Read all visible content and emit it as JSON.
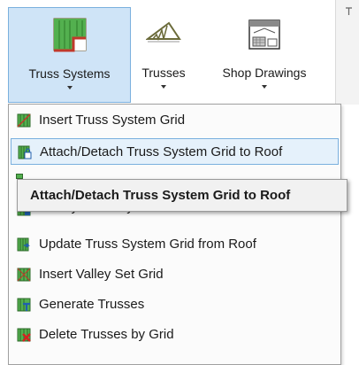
{
  "ribbon": {
    "buttons": [
      {
        "label": "Truss Systems",
        "icon": "truss-system-icon",
        "selected": true
      },
      {
        "label": "Trusses",
        "icon": "truss-icon"
      },
      {
        "label": "Shop Drawings",
        "icon": "shop-drawings-icon"
      }
    ]
  },
  "menu": {
    "items": [
      {
        "label": "Insert Truss System Grid",
        "icon": "insert-grid-icon"
      },
      {
        "label": "Attach/Detach Truss System Grid to Roof",
        "icon": "attach-detach-icon",
        "highlighted": true
      },
      {
        "label": "Modify Truss System Grid",
        "icon": "modify-grid-icon"
      },
      {
        "label": "Update Truss System Grid from Roof",
        "icon": "update-grid-icon"
      },
      {
        "label": "Insert Valley Set Grid",
        "icon": "valley-set-icon"
      },
      {
        "label": "Generate Trusses",
        "icon": "generate-trusses-icon"
      },
      {
        "label": "Delete Trusses by Grid",
        "icon": "delete-trusses-icon"
      }
    ]
  },
  "tooltip": {
    "text": "Attach/Detach Truss System Grid to Roof"
  },
  "colors": {
    "selected_bg": "#cfe4f7",
    "selected_border": "#7ab0de",
    "grid_green": "#3ea33e",
    "roof_red": "#c0392b"
  }
}
